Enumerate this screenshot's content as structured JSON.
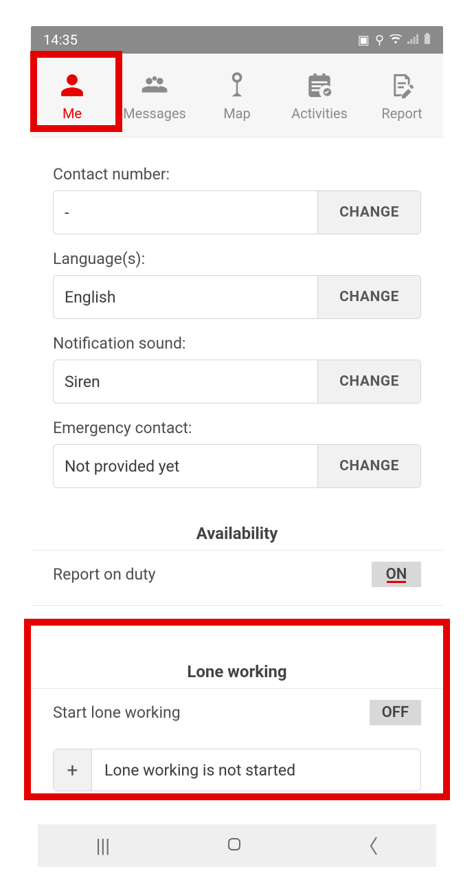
{
  "statusBar": {
    "time": "14:35"
  },
  "tabs": [
    {
      "label": "Me",
      "active": true
    },
    {
      "label": "Messages",
      "active": false
    },
    {
      "label": "Map",
      "active": false
    },
    {
      "label": "Activities",
      "active": false
    },
    {
      "label": "Report",
      "active": false
    }
  ],
  "fields": {
    "contactNumber": {
      "label": "Contact number:",
      "value": "-",
      "button": "CHANGE"
    },
    "languages": {
      "label": "Language(s):",
      "value": "English",
      "button": "CHANGE"
    },
    "notificationSound": {
      "label": "Notification sound:",
      "value": "Siren",
      "button": "CHANGE"
    },
    "emergencyContact": {
      "label": "Emergency contact:",
      "value": "Not provided yet",
      "button": "CHANGE"
    }
  },
  "availability": {
    "title": "Availability",
    "reportOnDuty": {
      "label": "Report on duty",
      "state": "ON"
    }
  },
  "loneWorking": {
    "title": "Lone working",
    "startLone": {
      "label": "Start lone working",
      "state": "OFF"
    },
    "plus": "+",
    "statusText": "Lone working is not started"
  }
}
